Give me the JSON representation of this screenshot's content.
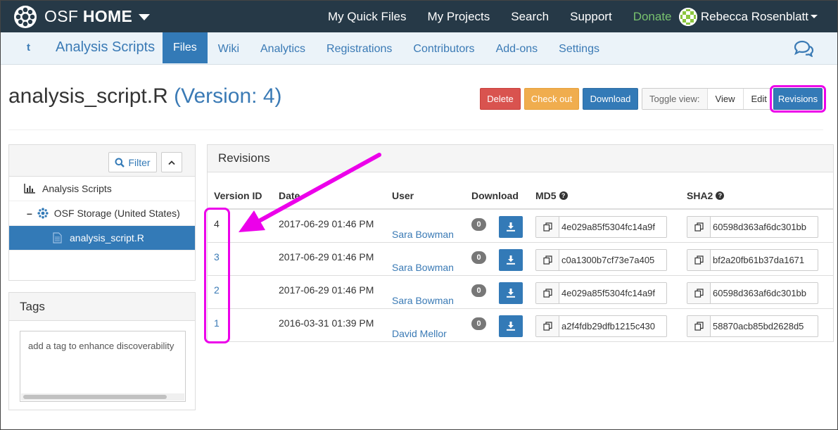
{
  "nav": {
    "brand_light": "OSF",
    "brand_bold": "HOME",
    "links": [
      "My Quick Files",
      "My Projects",
      "Search",
      "Support",
      "Donate"
    ],
    "user": "Rebecca Rosenblatt"
  },
  "project": {
    "short": "t",
    "title": "Analysis Scripts",
    "tabs": [
      "Files",
      "Wiki",
      "Analytics",
      "Registrations",
      "Contributors",
      "Add-ons",
      "Settings"
    ],
    "active_tab": "Files"
  },
  "file": {
    "name": "analysis_script.R",
    "version_label": "(Version: 4)"
  },
  "actions": {
    "delete": "Delete",
    "checkout": "Check out",
    "download": "Download",
    "toggle_label": "Toggle view:",
    "view": "View",
    "edit": "Edit",
    "revisions": "Revisions"
  },
  "tree": {
    "filter": "Filter",
    "project": "Analysis Scripts",
    "collapse_sign": "–",
    "storage": "OSF Storage (United States)",
    "file": "analysis_script.R"
  },
  "tags": {
    "title": "Tags",
    "placeholder": "add a tag to enhance discoverability"
  },
  "revisions": {
    "title": "Revisions",
    "headers": {
      "version": "Version ID",
      "date": "Date",
      "user": "User",
      "download": "Download",
      "md5": "MD5",
      "sha2": "SHA2"
    },
    "rows": [
      {
        "version": "4",
        "date": "2017-06-29 01:46 PM",
        "user": "Sara Bowman",
        "downloads": "0",
        "md5": "4e029a85f5304fc14a9f",
        "sha2": "60598d363af6dc301bb"
      },
      {
        "version": "3",
        "date": "2017-06-29 01:46 PM",
        "user": "Sara Bowman",
        "downloads": "0",
        "md5": "c0a1300b7cf73e7a405",
        "sha2": "bf2a20fb61b37da1671"
      },
      {
        "version": "2",
        "date": "2017-06-29 01:46 PM",
        "user": "Sara Bowman",
        "downloads": "0",
        "md5": "4e029a85f5304fc14a9f",
        "sha2": "60598d363af6dc301bb"
      },
      {
        "version": "1",
        "date": "2016-03-31 01:39 PM",
        "user": "David Mellor",
        "downloads": "0",
        "md5": "a2f4fdb29dfb1215c430",
        "sha2": "58870acb85bd2628d5"
      }
    ]
  },
  "icons": {
    "brand": "osf-logo-icon",
    "comments": "comment-bubbles-icon",
    "filter": "search-icon",
    "collapse": "chevron-up-icon",
    "project": "bar-chart-icon",
    "storage": "osf-storage-icon",
    "file": "file-icon",
    "download": "download-icon",
    "copy": "copy-icon",
    "help": "question-circle-icon"
  },
  "colors": {
    "navbar": "#263947",
    "subnav": "#ebf3f9",
    "primary": "#337ab7",
    "danger": "#d9534f",
    "warning": "#f0ad4e",
    "donate": "#78c26e",
    "annotation": "#ec00ea"
  }
}
